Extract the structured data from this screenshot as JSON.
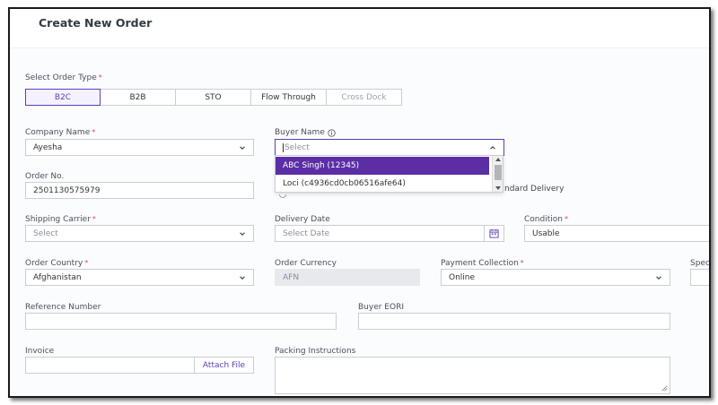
{
  "page": {
    "title": "Create New Order"
  },
  "order_type": {
    "label": "Select Order Type",
    "options": [
      "B2C",
      "B2B",
      "STO",
      "Flow Through",
      "Cross Dock"
    ],
    "selected": "B2C"
  },
  "company": {
    "label": "Company Name",
    "value": "Ayesha"
  },
  "buyer": {
    "label": "Buyer Name",
    "placeholder": "Select",
    "options": [
      "ABC Singh (12345)",
      "Loci (c4936cd0cb06516afe64)"
    ]
  },
  "order_no": {
    "label": "Order No.",
    "value": "2501130575979"
  },
  "delivery_type": {
    "partial_label": "ndard Delivery"
  },
  "shipping_carrier": {
    "label": "Shipping Carrier",
    "placeholder": "Select"
  },
  "delivery_date": {
    "label": "Delivery Date",
    "placeholder": "Select Date"
  },
  "condition": {
    "label": "Condition",
    "value": "Usable"
  },
  "order_country": {
    "label": "Order Country",
    "value": "Afghanistan"
  },
  "order_currency": {
    "label": "Order Currency",
    "value": "AFN"
  },
  "payment_collection": {
    "label": "Payment Collection",
    "value": "Online"
  },
  "spec": {
    "partial_label": "Spec"
  },
  "reference_number": {
    "label": "Reference Number",
    "value": ""
  },
  "buyer_eori": {
    "label": "Buyer EORI",
    "value": ""
  },
  "invoice": {
    "label": "Invoice",
    "attach_label": "Attach File"
  },
  "packing_instructions": {
    "label": "Packing Instructions",
    "value": ""
  },
  "colors": {
    "accent": "#5b3fb5",
    "selected_option_bg": "#5b2ea6",
    "required": "#e0455a"
  }
}
